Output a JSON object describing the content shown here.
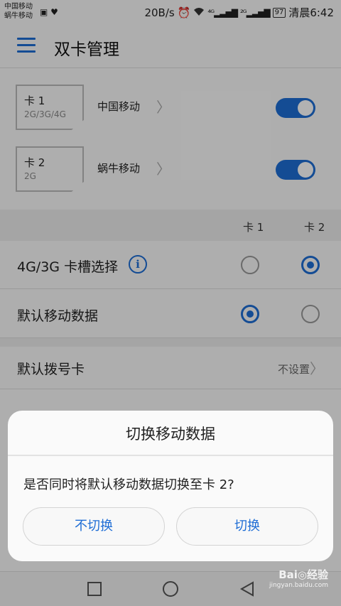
{
  "status_bar": {
    "carrier1": "中国移动",
    "carrier2": "蜗牛移动",
    "speed": "20B/s",
    "signal1": "⁴ᴳ",
    "signal2": "²ᴳ",
    "battery": "97",
    "time": "清晨6:42"
  },
  "app_bar": {
    "title": "双卡管理"
  },
  "sims": [
    {
      "slot": "卡 1",
      "network_types": "2G/3G/4G",
      "carrier": "中国移动",
      "enabled": true
    },
    {
      "slot": "卡 2",
      "network_types": "2G",
      "carrier": "蜗牛移动",
      "enabled": true
    }
  ],
  "columns": {
    "card1": "卡 1",
    "card2": "卡 2"
  },
  "options": [
    {
      "label": "4G/3G 卡槽选择",
      "selected": "card2"
    },
    {
      "label": "默认移动数据",
      "selected": "card1"
    }
  ],
  "default_dial": {
    "label": "默认拨号卡",
    "value": "不设置"
  },
  "dialog": {
    "title": "切换移动数据",
    "message": "是否同时将默认移动数据切换至卡 2?",
    "cancel_label": "不切换",
    "confirm_label": "切换"
  },
  "watermark": {
    "logo": "Bai◎经验",
    "sub": "jingyan.baidu.com"
  },
  "colors": {
    "accent": "#1e6dd5",
    "overlay": "rgba(0,0,0,0.30)"
  }
}
